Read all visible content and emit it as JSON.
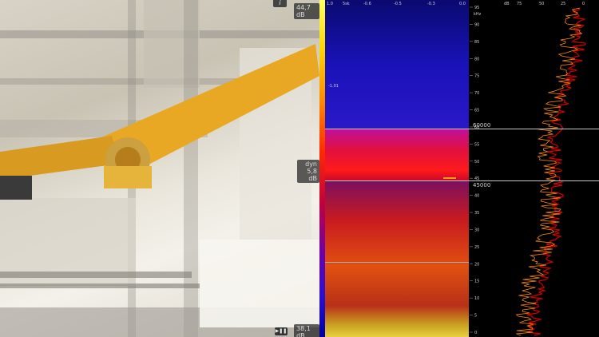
{
  "camera": {
    "info_label": "i",
    "level_top": "44,7 dB",
    "dyn_label": "dyn",
    "dyn_value": "5,8 dB",
    "level_bottom": "38,1 dB",
    "play_label": "▶❚❚"
  },
  "spectrogram": {
    "time_ticks": [
      "1.0",
      "5sk",
      "-0.6",
      "-0.5",
      "-0.3",
      "0.0"
    ],
    "marker_label": "-1.01",
    "marker_60000": "60000",
    "marker_45000": "45000"
  },
  "frequency_panel": {
    "level_ticks": [
      "dB",
      "75",
      "50",
      "25",
      "0"
    ],
    "khz_unit": "kHz",
    "khz_ticks": [
      "95",
      "90",
      "85",
      "80",
      "75",
      "70",
      "65",
      "60",
      "55",
      "50",
      "45",
      "40",
      "35",
      "30",
      "25",
      "20",
      "15",
      "10",
      "5",
      "0"
    ],
    "collapse_icon": "chevron-left-icon"
  },
  "colors": {
    "spectrum_trace_orange": "#ff8c00",
    "spectrum_trace_red": "#d20000",
    "marker_line": "#c8c8c8"
  }
}
